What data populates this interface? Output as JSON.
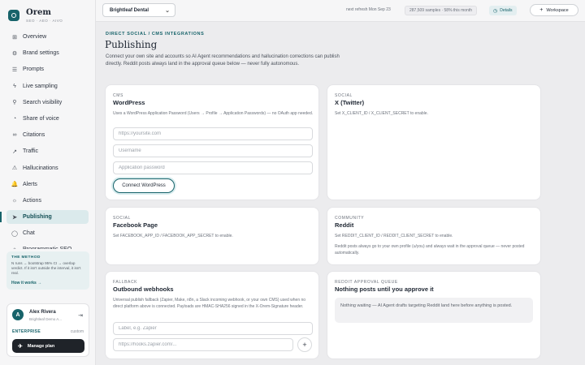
{
  "brand": {
    "name": "Orem",
    "tagline": "SEO · AEO · AIVO"
  },
  "nav": [
    {
      "label": "Overview",
      "icon": "grid-icon",
      "glyph": "⊞"
    },
    {
      "label": "Brand settings",
      "icon": "settings-icon",
      "glyph": "⚙"
    },
    {
      "label": "Prompts",
      "icon": "list-icon",
      "glyph": "☰"
    },
    {
      "label": "Live sampling",
      "icon": "pulse-icon",
      "glyph": "ϟ"
    },
    {
      "label": "Search visibility",
      "icon": "search-icon",
      "glyph": "⚲"
    },
    {
      "label": "Share of voice",
      "icon": "pie-icon",
      "glyph": "◔"
    },
    {
      "label": "Citations",
      "icon": "link-icon",
      "glyph": "∞"
    },
    {
      "label": "Traffic",
      "icon": "trend-icon",
      "glyph": "↗"
    },
    {
      "label": "Hallucinations",
      "icon": "warning-icon",
      "glyph": "⚠"
    },
    {
      "label": "Alerts",
      "icon": "bell-icon",
      "glyph": "🔔"
    },
    {
      "label": "Actions",
      "icon": "lightbulb-icon",
      "glyph": "☼"
    },
    {
      "label": "Publishing",
      "icon": "send-icon",
      "glyph": "➤"
    },
    {
      "label": "Chat",
      "icon": "chat-icon",
      "glyph": "◯"
    },
    {
      "label": "Programmatic SEO",
      "icon": "code-icon",
      "glyph": "◇"
    }
  ],
  "active_nav": "Publishing",
  "method": {
    "title": "THE METHOD",
    "text": "N runs → bootstrap 95% CI → overlap verdict. If it isn't outside the interval, it isn't real.",
    "link": "How it works →"
  },
  "user": {
    "initial": "A",
    "name": "Alex Rivera",
    "org": "Brightleaf Demo A...",
    "plan": "ENTERPRISE",
    "plan_type": "custom",
    "manage_label": "Manage plan"
  },
  "topbar": {
    "clinic": "Brightleaf Dental",
    "refresh": "next refresh Mon Sep 23",
    "samples": "287,509 samples · 58% this month",
    "details": "Details",
    "workspace": "Workspace"
  },
  "page": {
    "breadcrumb": "DIRECT SOCIAL / CMS INTEGRATIONS",
    "title": "Publishing",
    "description": "Connect your own site and accounts so AI Agent recommendations and hallucination corrections can publish directly. Reddit posts always land in the approval queue below — never fully autonomous."
  },
  "cards": {
    "wordpress": {
      "eyebrow": "CMS",
      "title": "WordPress",
      "text": "Uses a WordPress Application Password (Users → Profile → Application Passwords) — no OAuth app needed.",
      "site_placeholder": "https://yoursite.com",
      "username_placeholder": "Username",
      "password_placeholder": "Application password",
      "button": "Connect WordPress"
    },
    "twitter": {
      "eyebrow": "SOCIAL",
      "title": "X (Twitter)",
      "text": "Set X_CLIENT_ID / X_CLIENT_SECRET to enable."
    },
    "facebook": {
      "eyebrow": "SOCIAL",
      "title": "Facebook Page",
      "text": "Set FACEBOOK_APP_ID / FACEBOOK_APP_SECRET to enable."
    },
    "reddit": {
      "eyebrow": "COMMUNITY",
      "title": "Reddit",
      "text": "Set REDDIT_CLIENT_ID / REDDIT_CLIENT_SECRET to enable.",
      "note": "Reddit posts always go to your own profile (u/you) and always wait in the approval queue — never posted automatically."
    },
    "webhooks": {
      "eyebrow": "FALLBACK",
      "title": "Outbound webhooks",
      "text": "Universal publish fallback (Zapier, Make, n8n, a Slack incoming webhook, or your own CMS) used when no direct platform above is connected. Payloads are HMAC-SHA256 signed in the X-Orem-Signature header.",
      "label_placeholder": "Label, e.g. Zapier",
      "url_placeholder": "https://hooks.zapier.com/...",
      "add": "+"
    },
    "queue": {
      "eyebrow": "REDDIT APPROVAL QUEUE",
      "title": "Nothing posts until you approve it",
      "empty": "Nothing waiting — AI Agent drafts targeting Reddit land here before anything is posted."
    }
  },
  "colors": {
    "accent": "#17636a",
    "active_bg": "#dbeaec",
    "dark_button": "#1f2329"
  }
}
